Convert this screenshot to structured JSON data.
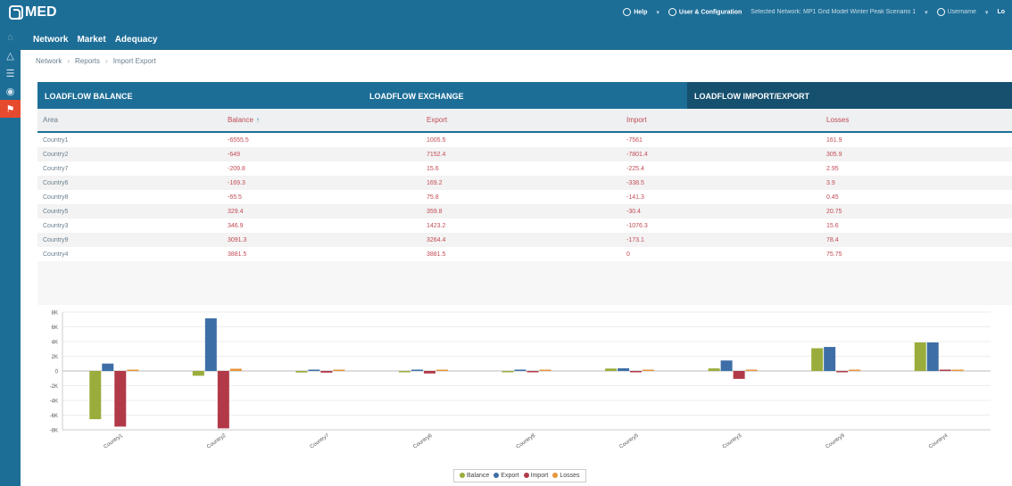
{
  "app": {
    "logo_text": "MED"
  },
  "topbar": {
    "help_label": "Help",
    "user_config_label": "User & Configuration",
    "network_selected": "Selected Network: MP1 Grid Model Winter Peak Scenario 1",
    "username": "Username",
    "logout_label": "Lo"
  },
  "nav": {
    "items": [
      "Network",
      "Market",
      "Adequacy"
    ]
  },
  "breadcrumb": {
    "items": [
      "Network",
      "Reports",
      "Import Export"
    ]
  },
  "tabs": [
    "LOADFLOW BALANCE",
    "LOADFLOW EXCHANGE",
    "LOADFLOW IMPORT/EXPORT"
  ],
  "table": {
    "columns": [
      "Area",
      "Balance",
      "Export",
      "Import",
      "Losses"
    ],
    "sort_indicator": "↑",
    "rows": [
      [
        "Country1",
        "-6555.5",
        "1005.5",
        "-7561",
        "161.9"
      ],
      [
        "Country2",
        "-649",
        "7152.4",
        "-7801.4",
        "305.9"
      ],
      [
        "Country7",
        "-209.8",
        "15.6",
        "-225.4",
        "2.95"
      ],
      [
        "Country6",
        "-169.3",
        "169.2",
        "-338.5",
        "3.9"
      ],
      [
        "Country8",
        "-65.5",
        "75.8",
        "-141.3",
        "0.45"
      ],
      [
        "Country5",
        "329.4",
        "359.8",
        "-30.4",
        "20.75"
      ],
      [
        "Country3",
        "346.9",
        "1423.2",
        "-1076.3",
        "15.6"
      ],
      [
        "Country9",
        "3091.3",
        "3264.4",
        "-173.1",
        "78.4"
      ],
      [
        "Country4",
        "3881.5",
        "3881.5",
        "0",
        "75.75"
      ]
    ]
  },
  "chart_data": {
    "type": "bar",
    "categories": [
      "Country1",
      "Country2",
      "Country7",
      "Country6",
      "Country8",
      "Country5",
      "Country3",
      "Country9",
      "Country4"
    ],
    "series": [
      {
        "name": "Balance",
        "color": "#9aad3c",
        "values": [
          -6555.5,
          -649,
          -209.8,
          -169.3,
          -65.5,
          329.4,
          346.9,
          3091.3,
          3881.5
        ]
      },
      {
        "name": "Export",
        "color": "#3d6fa6",
        "values": [
          1005.5,
          7152.4,
          15.6,
          169.2,
          75.8,
          359.8,
          1423.2,
          3264.4,
          3881.5
        ]
      },
      {
        "name": "Import",
        "color": "#b23a48",
        "values": [
          -7561,
          -7801.4,
          -225.4,
          -338.5,
          -141.3,
          -30.4,
          -1076.3,
          -173.1,
          0
        ]
      },
      {
        "name": "Losses",
        "color": "#e8953a",
        "values": [
          161.9,
          305.9,
          2.95,
          3.9,
          0.45,
          20.75,
          15.6,
          78.4,
          75.75
        ]
      }
    ],
    "yticks": [
      "8K",
      "6K",
      "4K",
      "2K",
      "0",
      "-2K",
      "-4K",
      "-6K",
      "-8K"
    ],
    "ylim": [
      -8000,
      8000
    ],
    "grid": true,
    "legend_position": "bottom"
  }
}
